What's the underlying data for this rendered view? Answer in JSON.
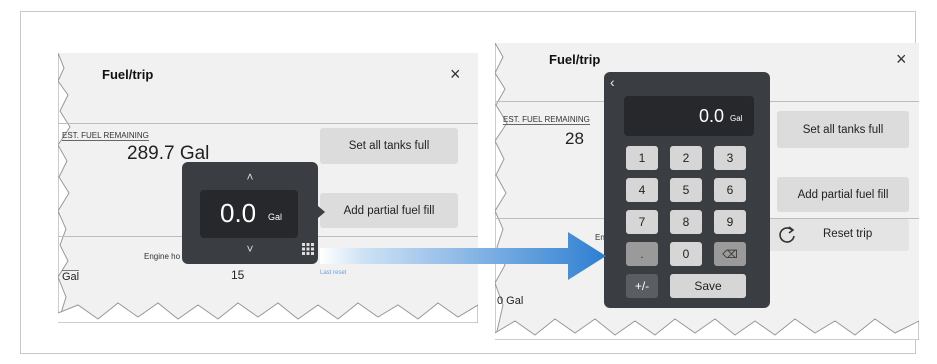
{
  "left": {
    "title": "Fuel/trip",
    "close": "×",
    "est_fuel_label": "EST. FUEL REMAINING",
    "est_fuel_value": "289.7 Gal",
    "set_all_tanks_full": "Set all tanks full",
    "add_partial_fuel_fill": "Add partial fuel fill",
    "engine_hours_label": "Engine ho",
    "engine_hours_value": "15",
    "gal_value": "Gal",
    "bottom_tiny_label": "Last reset",
    "popup": {
      "up_arrow": "˄",
      "value": "0.0",
      "unit": "Gal",
      "down_arrow": "˅",
      "keypad_icon": "keypad-icon"
    }
  },
  "right": {
    "title": "Fuel/trip",
    "close": "×",
    "est_fuel_label": "EST. FUEL REMAINING",
    "est_fuel_value_partial": "28",
    "set_all_tanks_full": "Set all tanks full",
    "add_partial_fuel_fill": "Add partial fuel fill",
    "reset_trip": "Reset trip",
    "engine_label_partial": "En",
    "gal_value": "0 Gal",
    "keypad": {
      "back": "‹",
      "value": "0.0",
      "unit": "Gal",
      "keys": [
        "1",
        "2",
        "3",
        "4",
        "5",
        "6",
        "7",
        "8",
        "9",
        ".",
        "0",
        "⌫"
      ],
      "plus_minus": "+/-",
      "save": "Save"
    }
  },
  "colors": {
    "arrow": "#2e7fd1",
    "panel_bg": "#f1f1f1",
    "button_bg": "#dcdcdc",
    "dark_popup": "#3a3d42"
  }
}
